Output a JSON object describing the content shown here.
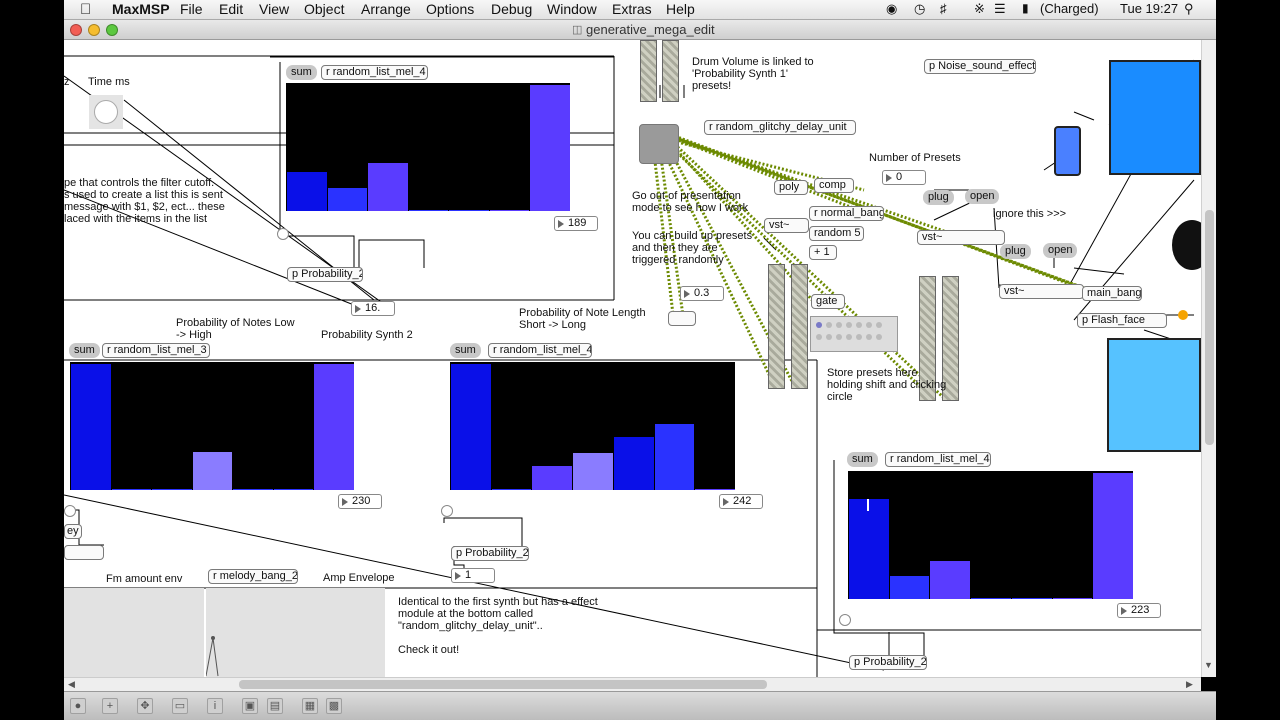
{
  "menubar": {
    "app_name": "MaxMSP",
    "items": [
      "File",
      "Edit",
      "View",
      "Object",
      "Arrange",
      "Options",
      "Debug",
      "Window",
      "Extras",
      "Help"
    ],
    "battery": "(Charged)",
    "clock": "Tue 19:27"
  },
  "window": {
    "title": "generative_mega_edit"
  },
  "comments": {
    "time_ms": "Time ms",
    "filter_lines": [
      "pe that controls the filter cutoff.",
      "s used to create a list this is sent",
      "message with $1, $2, ect... these",
      "laced with the items in the list"
    ],
    "prob_notes_lines": [
      "Probability of Notes Low",
      "-> High"
    ],
    "prob_synth2": "Probability Synth 2",
    "prob_length_lines": [
      "Probability of Note Length",
      "Short -> Long"
    ],
    "drum_volume_lines": [
      "Drum Volume is linked to",
      "'Probability Synth 1'",
      "presets!"
    ],
    "number_of_presets": "Number of Presets",
    "go_out_lines": [
      "Go out of presentation",
      "mode to see how I work"
    ],
    "you_can_lines": [
      "You can build up presets",
      "and then they are",
      "triggered randomly"
    ],
    "ignore_this": "ignore this >>>",
    "store_lines": [
      "Store presets here",
      "holding shift and clicking",
      "circle"
    ],
    "fm_amount": "Fm amount env",
    "amp_envelope": "Amp Envelope",
    "identical_lines": [
      "Identical to the first synth but has a effect",
      "module at the bottom called",
      "\"random_glitchy_delay_unit\"..",
      "",
      "Check it out!"
    ],
    "z_fragment": "z",
    "key_fragment": "ey"
  },
  "objects": {
    "r_mel4_a": "r random_list_mel_4",
    "r_mel3": "r random_list_mel_3",
    "r_mel4_b": "r random_list_mel_4",
    "r_mel4_c": "r random_list_mel_4",
    "p_prob_a": "p Probability_2",
    "p_prob_b": "p Probability_2",
    "p_prob_c": "p Probability_2",
    "p_noise": "p Noise_sound_effect",
    "r_glitchy": "r random_glitchy_delay_unit",
    "r_melody_bang": "r melody_bang_2",
    "r_normal_bang": "r normal_bang",
    "random5": "random 5",
    "plus1": "+ 1",
    "gate": "gate",
    "vst_a": "vst~",
    "vst_b": "vst~",
    "vst_c": "vst~",
    "main_bang": "main_bang",
    "p_flash": "p Flash_face",
    "poly": "poly",
    "comp": "comp"
  },
  "messages": {
    "sum_a": "sum",
    "sum_b": "sum",
    "sum_c": "sum",
    "sum_d": "sum",
    "plug_a": "plug",
    "open_a": "open",
    "plug_b": "plug",
    "open_b": "open"
  },
  "numbers": {
    "n189": "189",
    "n16": "16.",
    "n230": "230",
    "n242": "242",
    "n1": "1",
    "n223": "223",
    "n0": "0",
    "n03": "0.3"
  },
  "multisliders": {
    "top": {
      "values": [
        0.31,
        0.18,
        0.38,
        0.01,
        0.0,
        0.0,
        1.0
      ]
    },
    "left": {
      "values": [
        1.0,
        0.0,
        0.0,
        0.3,
        0.0,
        0.0,
        1.0
      ]
    },
    "mid": {
      "values": [
        1.0,
        0.0,
        0.19,
        0.29,
        0.42,
        0.52,
        0.0
      ]
    },
    "right": {
      "values": [
        0.79,
        0.18,
        0.3,
        0.01,
        0.0,
        0.0,
        1.0
      ]
    }
  },
  "colors": {
    "bar_blue": "#0a10e8",
    "bar_mid": "#2a32ff",
    "bar_violet": "#5a3cff",
    "bar_light": "#8a7cff",
    "patch_cord_green": "#6c8a00",
    "lcd_blue": "#1a8cff",
    "lcd_light": "#56c2ff"
  }
}
